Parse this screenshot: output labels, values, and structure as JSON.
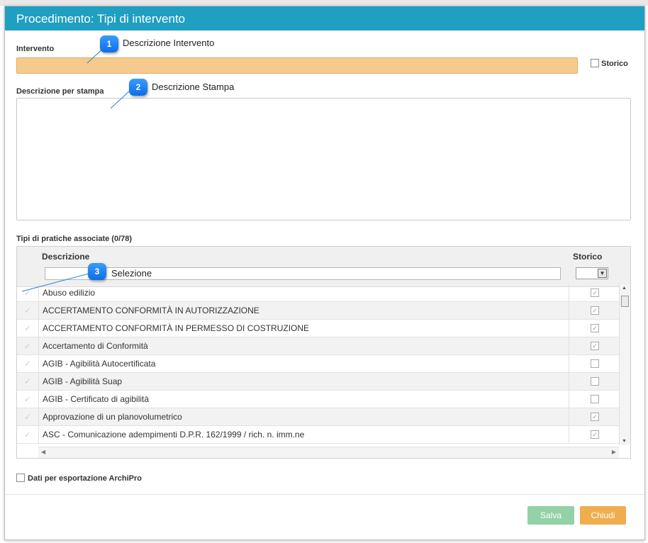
{
  "dialog": {
    "title": "Procedimento: Tipi di intervento"
  },
  "form": {
    "intervento_label": "Intervento",
    "intervento_value": "",
    "storico_label": "Storico",
    "descrizione_stampa_label": "Descrizione per stampa",
    "descrizione_stampa_value": ""
  },
  "callouts": [
    {
      "number": "1",
      "text": "Descrizione Intervento"
    },
    {
      "number": "2",
      "text": "Descrizione Stampa"
    },
    {
      "number": "3",
      "text": "Selezione"
    }
  ],
  "grid": {
    "title": "Tipi di pratiche associate (0/78)",
    "col_descrizione": "Descrizione",
    "col_storico": "Storico",
    "filter_value": "",
    "rows": [
      {
        "descrizione": "Abuso edilizio",
        "storico": true
      },
      {
        "descrizione": "ACCERTAMENTO CONFORMITÀ IN AUTORIZZAZIONE",
        "storico": true
      },
      {
        "descrizione": "ACCERTAMENTO CONFORMITÀ IN PERMESSO DI COSTRUZIONE",
        "storico": true
      },
      {
        "descrizione": "Accertamento di Conformità",
        "storico": true
      },
      {
        "descrizione": "AGIB - Agibilità Autocertificata",
        "storico": false
      },
      {
        "descrizione": "AGIB - Agibilità Suap",
        "storico": false
      },
      {
        "descrizione": "AGIB - Certificato di agibilità",
        "storico": false
      },
      {
        "descrizione": "Approvazione di un planovolumetrico",
        "storico": true
      },
      {
        "descrizione": "ASC - Comunicazione adempimenti D.P.R. 162/1999 / rich. n. imm.ne",
        "storico": true
      }
    ]
  },
  "footer": {
    "archipro_label": "Dati per esportazione ArchiPro",
    "save_label": "Salva",
    "close_label": "Chiudi"
  },
  "colors": {
    "titlebar": "#1f9fc1",
    "intervento_field": "#f6ca8e",
    "save_button": "#93d1a6",
    "close_button": "#f0ad4e",
    "callout_badge": "#1a7ff0"
  }
}
